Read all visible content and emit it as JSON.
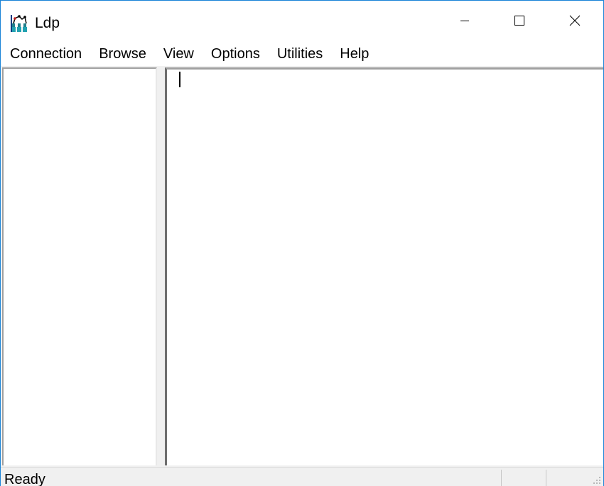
{
  "window": {
    "title": "Ldp",
    "app_icon": "ldp-app-icon",
    "controls": {
      "minimize_icon": "minimize-icon",
      "maximize_icon": "maximize-icon",
      "close_icon": "close-icon"
    },
    "accent_border": "#1883d7"
  },
  "menubar": {
    "items": [
      {
        "label": "Connection"
      },
      {
        "label": "Browse"
      },
      {
        "label": "View"
      },
      {
        "label": "Options"
      },
      {
        "label": "Utilities"
      },
      {
        "label": "Help"
      }
    ]
  },
  "tree_pane": {
    "items": []
  },
  "output_pane": {
    "text": ""
  },
  "statusbar": {
    "text": "Ready",
    "panel2": "",
    "panel3": ""
  }
}
